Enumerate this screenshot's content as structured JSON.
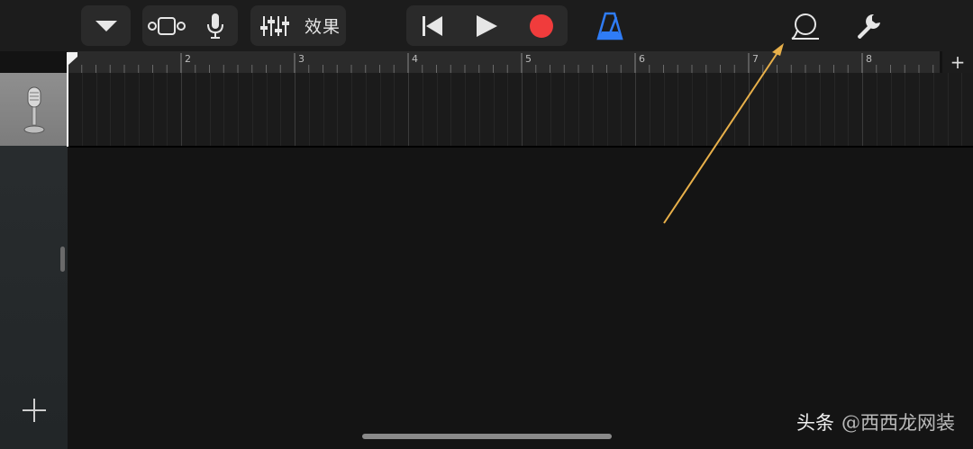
{
  "toolbar": {
    "effects_label": "效果",
    "icons": {
      "browser": "chevron-down-icon",
      "view": "track-view-icon",
      "instrument": "microphone-icon",
      "mixer": "mixer-sliders-icon",
      "rewind": "go-to-start-icon",
      "play": "play-icon",
      "record": "record-icon",
      "metronome": "metronome-icon",
      "loop": "loop-browser-icon",
      "settings": "wrench-icon"
    }
  },
  "ruler": {
    "bars": [
      "2",
      "3",
      "4",
      "5",
      "6",
      "7",
      "8"
    ],
    "add_section": "+"
  },
  "track": {
    "icon": "microphone-icon"
  },
  "sidebar": {
    "add_track": "+"
  },
  "watermark": {
    "brand": "头条",
    "seal": "@西西龙网装"
  },
  "colors": {
    "background": "#131313",
    "toolbar": "#1c1c1c",
    "record": "#f03c3c",
    "metronome": "#2f7cf6",
    "annotation": "#e8b04a",
    "track_header": "#878787"
  }
}
